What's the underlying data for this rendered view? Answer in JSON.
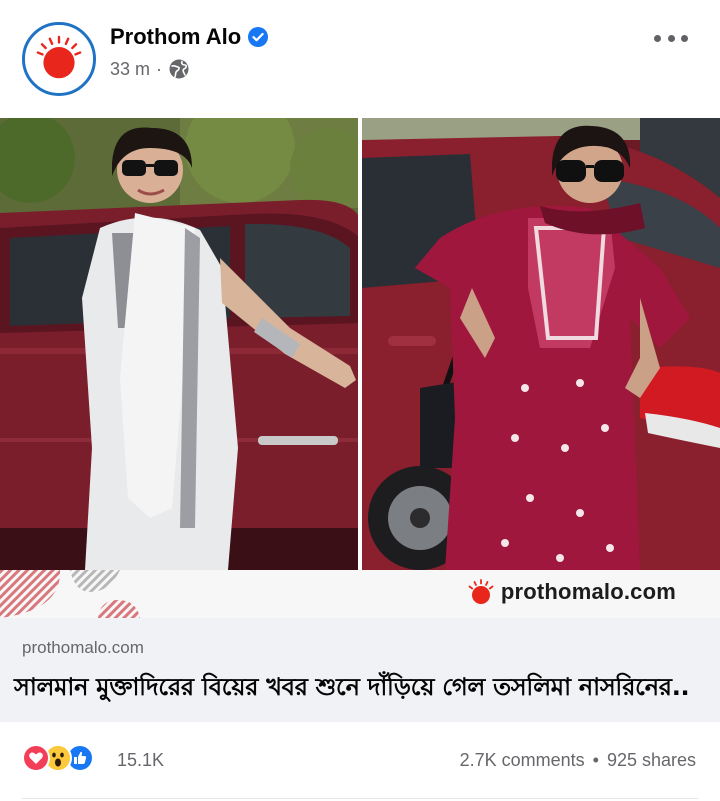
{
  "post": {
    "page_name": "Prothom Alo",
    "time": "33 m",
    "separator": "·",
    "privacy_icon": "globe-icon",
    "verified_icon": "verified-badge-icon",
    "more_icon": "more-options-icon"
  },
  "watermark": {
    "site": "prothomalo.com"
  },
  "link_preview": {
    "domain": "prothomalo.com",
    "title": "সালমান মুক্তাদিরের বিয়ের খবর শুনে দাঁড়িয়ে গেল তসলিমা নাসরিনের.."
  },
  "reactions": {
    "icons": [
      "love-reaction-icon",
      "wow-reaction-icon",
      "like-reaction-icon"
    ],
    "count": "15.1K",
    "comments": "2.7K comments",
    "dot": "•",
    "shares": "925 shares"
  },
  "colors": {
    "brand_red": "#e8261c",
    "facebook_blue": "#1877f2",
    "secondary_text": "#65676b",
    "preview_bg": "#f0f2f5"
  }
}
